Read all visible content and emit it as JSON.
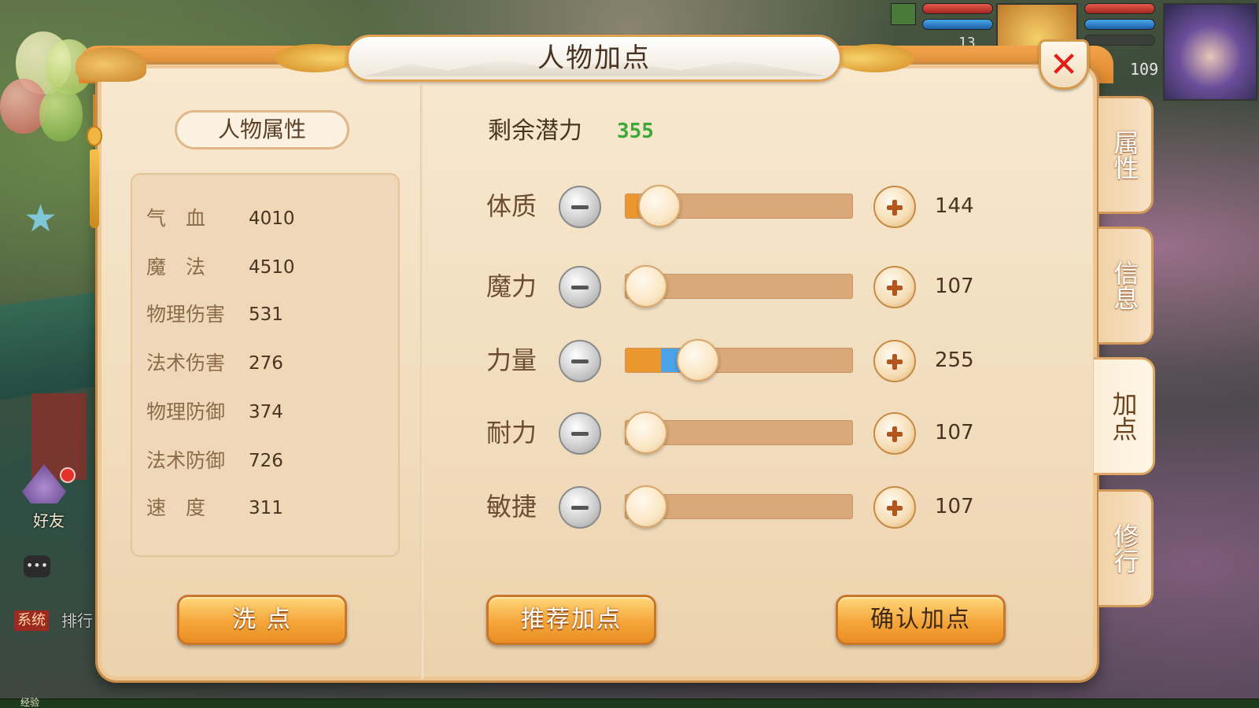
{
  "window": {
    "title": "人物加点",
    "close_icon": "✕"
  },
  "left_panel": {
    "header": "人物属性",
    "attributes": [
      {
        "label": "气　血",
        "value": "4010"
      },
      {
        "label": "魔　法",
        "value": "4510"
      },
      {
        "label": "物理伤害",
        "value": "531"
      },
      {
        "label": "法术伤害",
        "value": "276"
      },
      {
        "label": "物理防御",
        "value": "374"
      },
      {
        "label": "法术防御",
        "value": "726"
      },
      {
        "label": "速　度",
        "value": "311"
      }
    ],
    "reset_button": "洗 点"
  },
  "right_panel": {
    "remaining_label": "剩余潜力",
    "remaining_value": "355",
    "stats": [
      {
        "label": "体质",
        "value": "144",
        "fill_orange": 0.06,
        "fill_blue": 0.0,
        "knob": 0.15
      },
      {
        "label": "魔力",
        "value": "107",
        "fill_orange": 0.0,
        "fill_blue": 0.0,
        "knob": 0.09
      },
      {
        "label": "力量",
        "value": "255",
        "fill_orange": 0.155,
        "fill_blue": 0.09,
        "knob": 0.32
      },
      {
        "label": "耐力",
        "value": "107",
        "fill_orange": 0.0,
        "fill_blue": 0.0,
        "knob": 0.09
      },
      {
        "label": "敏捷",
        "value": "107",
        "fill_orange": 0.0,
        "fill_blue": 0.0,
        "knob": 0.09
      }
    ],
    "recommend_button": "推荐加点",
    "confirm_button": "确认加点"
  },
  "side_tabs": [
    {
      "label": "属性",
      "active": false
    },
    {
      "label": "信息",
      "active": false
    },
    {
      "label": "加点",
      "active": true
    },
    {
      "label": "修行",
      "active": false
    }
  ],
  "hud": {
    "friend_label": "好友",
    "system_tag": "系统",
    "chat_text": "排行",
    "pet_level": "13",
    "hero_level": "109",
    "exp_label": "经验",
    "chat_icon": "chat-bubble-icon"
  },
  "colors": {
    "panel_bg": "#f7e8cf",
    "accent_orange": "#ec962f",
    "accent_blue": "#4aa3e8",
    "remaining_green": "#3da83a",
    "close_red": "#e02018"
  }
}
